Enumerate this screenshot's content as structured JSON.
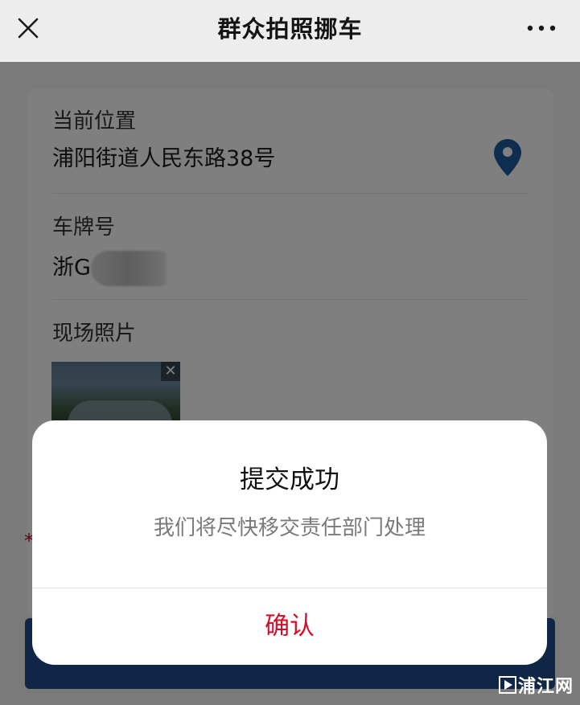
{
  "header": {
    "title": "群众拍照挪车"
  },
  "form": {
    "location_label": "当前位置",
    "location_value": "浦阳街道人民东路38号",
    "plate_label": "车牌号",
    "plate_value": "浙G",
    "photo_label": "现场照片",
    "required_mark": "*"
  },
  "dialog": {
    "title": "提交成功",
    "message": "我们将尽快移交责任部门处理",
    "confirm_label": "确认"
  },
  "watermark": {
    "text": "浦江网"
  },
  "colors": {
    "accent_red": "#d0102b",
    "pin_blue": "#1d5a9e",
    "submit_blue": "#1e4d8c"
  }
}
